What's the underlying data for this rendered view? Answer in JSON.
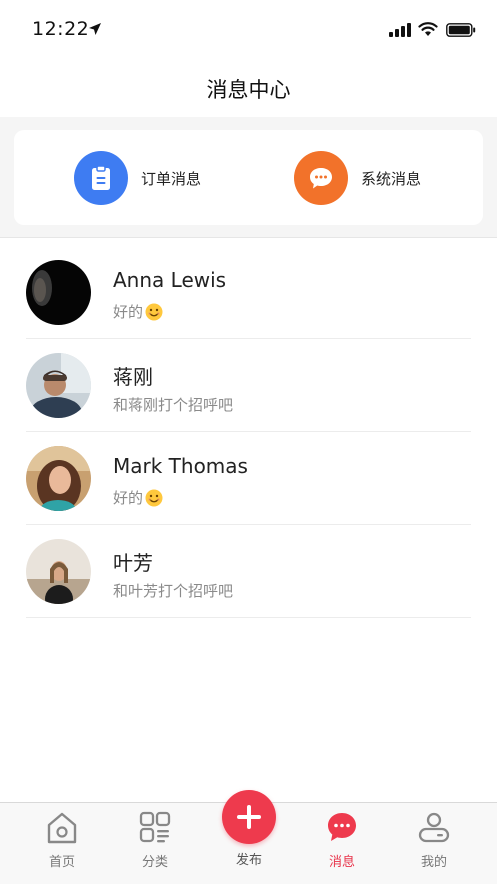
{
  "status_bar": {
    "time": "12:22"
  },
  "nav": {
    "title": "消息中心"
  },
  "categories": [
    {
      "label": "订单消息",
      "icon": "clipboard-icon",
      "color": "#3e7cf2"
    },
    {
      "label": "系统消息",
      "icon": "chat-bubble-icon",
      "color": "#f2722a"
    }
  ],
  "conversations": [
    {
      "name": "Anna Lewis",
      "message": "好的",
      "has_emoji": true
    },
    {
      "name": "蒋刚",
      "message": "和蒋刚打个招呼吧",
      "has_emoji": false
    },
    {
      "name": "Mark Thomas",
      "message": "好的",
      "has_emoji": true
    },
    {
      "name": "叶芳",
      "message": "和叶芳打个招呼吧",
      "has_emoji": false
    }
  ],
  "tabbar": {
    "items": [
      {
        "label": "首页",
        "icon": "home-icon",
        "active": false
      },
      {
        "label": "分类",
        "icon": "grid-icon",
        "active": false
      },
      {
        "label": "发布",
        "icon": "plus-icon",
        "active": false
      },
      {
        "label": "消息",
        "icon": "message-icon",
        "active": true
      },
      {
        "label": "我的",
        "icon": "profile-icon",
        "active": false
      }
    ],
    "active_color": "#e8334a",
    "inactive_color": "#777777"
  }
}
